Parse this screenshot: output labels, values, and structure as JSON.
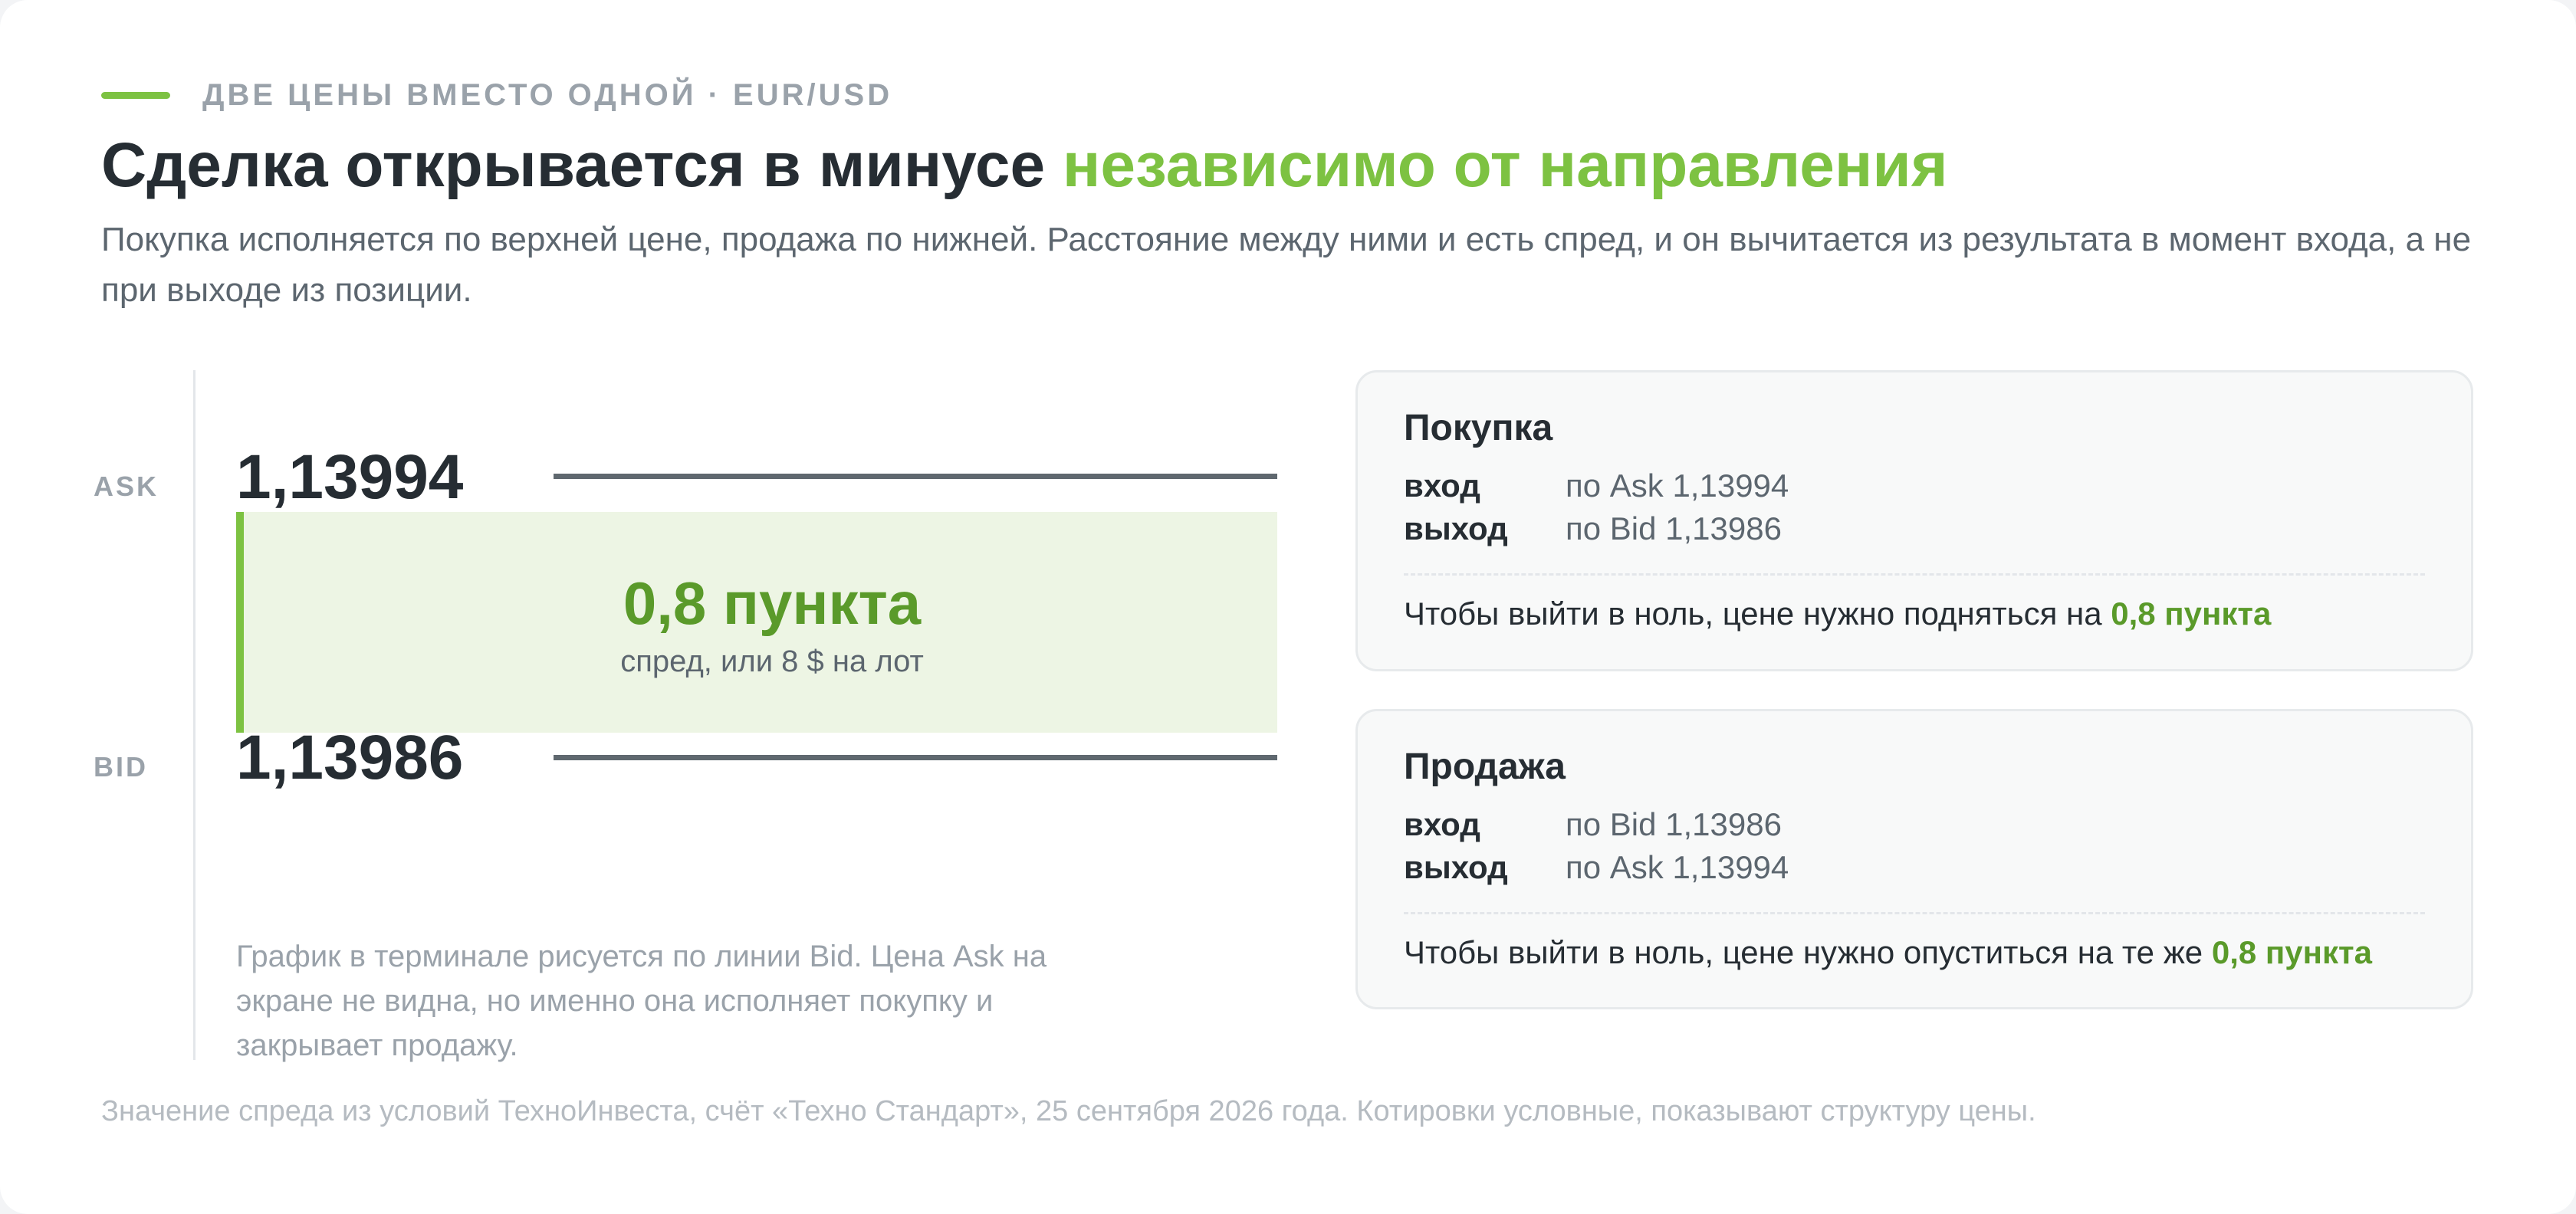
{
  "kicker": {
    "text": "ДВЕ ЦЕНЫ ВМЕСТО ОДНОЙ · EUR/USD"
  },
  "headline": {
    "main": "Сделка открывается в минусе",
    "accent": "независимо от направления"
  },
  "subtitle": "Покупка исполняется по верхней цене, продажа по нижней. Расстояние между ними и есть спред, и он вычитается из результата в момент входа, а не при выходе из позиции.",
  "quotes": {
    "ask_label": "ASK",
    "ask_price": "1,13994",
    "bid_label": "BID",
    "bid_price": "1,13986"
  },
  "spread": {
    "value": "0,8 пункта",
    "caption": "спред, или 8 $ на лот"
  },
  "chart_note": "График в терминале рисуется по линии Bid. Цена Ask на экране не видна, но именно она исполняет покупку и закрывает продажу.",
  "panels": {
    "buy": {
      "title": "Покупка",
      "entry_key": "вход",
      "entry_val": "по Ask 1,13994",
      "exit_key": "выход",
      "exit_val": "по Bid 1,13986",
      "result_text": "Чтобы выйти в ноль, цене нужно подняться на",
      "result_value": "0,8 пункта"
    },
    "sell": {
      "title": "Продажа",
      "entry_key": "вход",
      "entry_val": "по Bid 1,13986",
      "exit_key": "выход",
      "exit_val": "по Ask 1,13994",
      "result_text": "Чтобы выйти в ноль, цене нужно опуститься на те же",
      "result_value": "0,8 пункта"
    }
  },
  "footnote": "Значение спреда из условий ТехноИнвеста, счёт «Техно Стандарт», 25 сентября 2026 года. Котировки условные, показывают структуру цены.",
  "colors": {
    "accent": "#7dc242",
    "accent_dark": "#5a9a2a",
    "spread_fill": "#edf5e4",
    "text_dark": "#262d33",
    "text_muted": "#9aa2aa"
  }
}
